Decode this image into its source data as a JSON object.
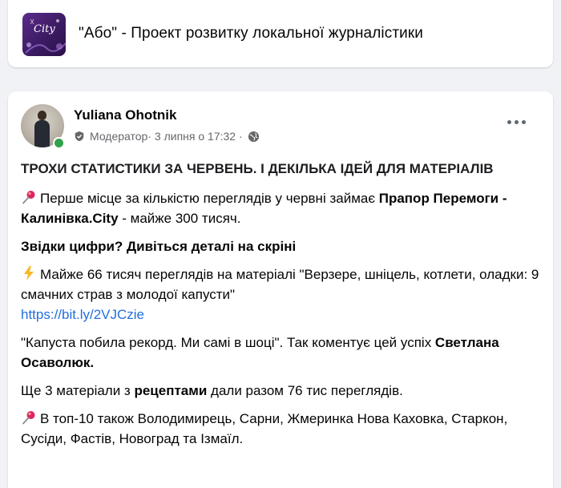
{
  "group": {
    "logo_text": "City",
    "title": "\"Або\" - Проект розвитку локальної журналістики"
  },
  "post": {
    "author": "Yuliana Ohotnik",
    "role": "Модератор",
    "date": " · 3 липня о 17:32 · ",
    "headline": "ТРОХИ СТАТИСТИКИ ЗА ЧЕРВЕНЬ. І ДЕКІЛЬКА ІДЕЙ ДЛЯ МАТЕРІАЛІВ",
    "p1_text": "Перше місце за кількістю переглядів у червні займає ",
    "p1_bold": "Прапор Перемоги - Калинівка.City",
    "p1_tail": " - майже 300 тисяч.",
    "p2_bold": "Звідки цифри? Дивіться деталі на скріні",
    "p3_text": "Майже 66 тисяч переглядів на матеріалі \"Верзере, шніцель, котлети, оладки: 9 смачних страв з молодої капусти\"",
    "p3_link": "https://bit.ly/2VJCzie",
    "p4_text": "\"Капуста побила рекорд. Ми самі в шоці\". Так коментує цей успіх ",
    "p4_bold": "Светлана Осаволюк.",
    "p5_text": "Ще 3 матеріали з ",
    "p5_bold": "рецептами",
    "p5_tail": " дали разом 76 тис переглядів.",
    "p6_text": "В топ-10 також Володимирець, Сарни, Жмеринка Нова Каховка, Старкон, Сусіди, Фастів, Новоград та Ізмаїл."
  },
  "icons": {
    "shield": "shield-icon",
    "globe": "globe-icon",
    "pin": "pushpin-icon",
    "bolt": "lightning-icon",
    "more": "more-options-icon"
  },
  "colors": {
    "background": "#f0f2f5",
    "card": "#ffffff",
    "link": "#216fdb",
    "meta": "#65676b",
    "online": "#31a24c",
    "pin": "#e0245e",
    "bolt": "#f7b928"
  }
}
